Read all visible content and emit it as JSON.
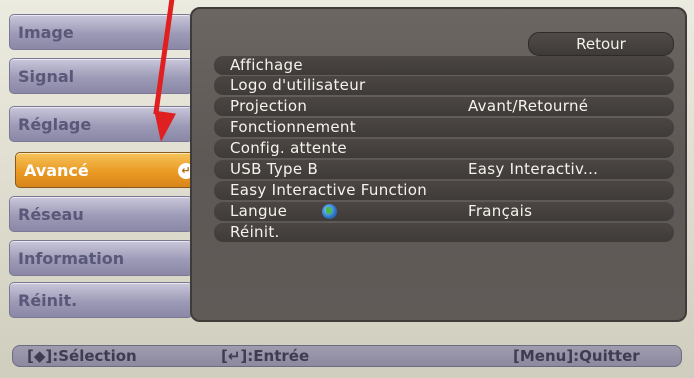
{
  "sidebar": {
    "items": [
      {
        "label": "Image"
      },
      {
        "label": "Signal"
      },
      {
        "label": "Réglage"
      },
      {
        "label": "Avancé",
        "active": true
      },
      {
        "label": "Réseau"
      },
      {
        "label": "Information"
      },
      {
        "label": "Réinit."
      }
    ],
    "enter_icon_glyph": "↵"
  },
  "panel": {
    "retour_label": "Retour",
    "rows": [
      {
        "label": "Affichage",
        "value": ""
      },
      {
        "label": "Logo d'utilisateur",
        "value": ""
      },
      {
        "label": "Projection",
        "value": "Avant/Retourné"
      },
      {
        "label": "Fonctionnement",
        "value": ""
      },
      {
        "label": "Config. attente",
        "value": ""
      },
      {
        "label": "USB Type B",
        "value": "Easy Interactiv..."
      },
      {
        "label": "Easy Interactive Function",
        "value": ""
      },
      {
        "label": "Langue",
        "value": "Français",
        "icon": "globe-icon"
      },
      {
        "label": "Réinit.",
        "value": ""
      }
    ]
  },
  "bottom_bar": {
    "selection": "[◆]:Sélection",
    "enter": "[↵]:Entrée",
    "quit": "[Menu]:Quitter"
  },
  "annotation": {
    "color": "#e02020",
    "icon": "red-arrow"
  }
}
